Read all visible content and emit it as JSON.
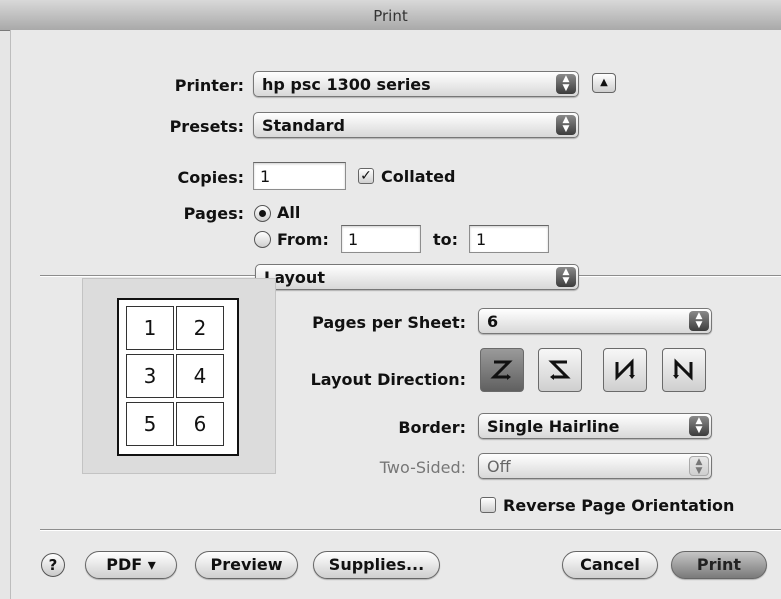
{
  "window": {
    "title": "Print"
  },
  "printer": {
    "label": "Printer:",
    "value": "hp psc 1300 series",
    "disclosure_icon": "triangle-up-icon"
  },
  "presets": {
    "label": "Presets:",
    "value": "Standard"
  },
  "copies": {
    "label": "Copies:",
    "value": "1",
    "collated_label": "Collated",
    "collated_checked": true
  },
  "pages": {
    "label": "Pages:",
    "all_label": "All",
    "from_label": "From:",
    "from_value": "1",
    "to_label": "to:",
    "to_value": "1",
    "selected": "All"
  },
  "section": {
    "value": "Layout"
  },
  "preview": {
    "cells": [
      "1",
      "2",
      "3",
      "4",
      "5",
      "6"
    ]
  },
  "layout": {
    "pages_per_sheet_label": "Pages per Sheet:",
    "pages_per_sheet_value": "6",
    "direction_label": "Layout Direction:",
    "directions": [
      "z-left-right-icon",
      "s-reverse-icon",
      "n-top-bottom-icon",
      "n-reverse-icon"
    ],
    "selected_direction": "z-left-right-icon",
    "border_label": "Border:",
    "border_value": "Single Hairline",
    "two_sided_label": "Two-Sided:",
    "two_sided_value": "Off",
    "reverse_label": "Reverse Page Orientation",
    "reverse_checked": false
  },
  "footer": {
    "help_label": "?",
    "pdf_label": "PDF ▾",
    "preview_label": "Preview",
    "supplies_label": "Supplies...",
    "cancel_label": "Cancel",
    "print_label": "Print"
  }
}
